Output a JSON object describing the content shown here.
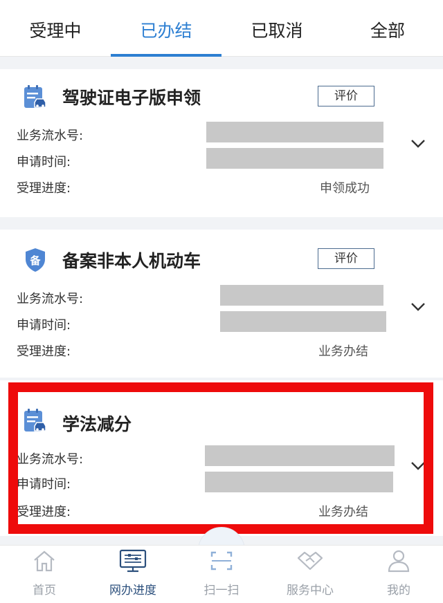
{
  "tabs": [
    {
      "label": "受理中"
    },
    {
      "label": "已办结"
    },
    {
      "label": "已取消"
    },
    {
      "label": "全部"
    }
  ],
  "field_labels": {
    "serial": "业务流水号:",
    "apply_time": "申请时间:",
    "progress": "受理进度:"
  },
  "cards": [
    {
      "title": "驾驶证电子版申领",
      "rate_label": "评价",
      "status": "申领成功",
      "icon": "vehicle-doc-icon"
    },
    {
      "title": "备案非本人机动车",
      "rate_label": "评价",
      "status": "业务办结",
      "icon": "shield-bei-icon",
      "icon_text": "备"
    },
    {
      "title": "学法减分",
      "status": "业务办结",
      "icon": "vehicle-doc-icon"
    }
  ],
  "nav": [
    {
      "label": "首页",
      "icon": "home-icon"
    },
    {
      "label": "网办进度",
      "icon": "monitor-progress-icon"
    },
    {
      "label": "扫一扫",
      "icon": "scan-icon"
    },
    {
      "label": "服务中心",
      "icon": "handshake-icon"
    },
    {
      "label": "我的",
      "icon": "user-icon"
    }
  ],
  "colors": {
    "accent": "#2d7fd2",
    "highlight": "#ee0b0b",
    "redaction": "#c8c8c8",
    "nav_active": "#2b4f7c"
  }
}
